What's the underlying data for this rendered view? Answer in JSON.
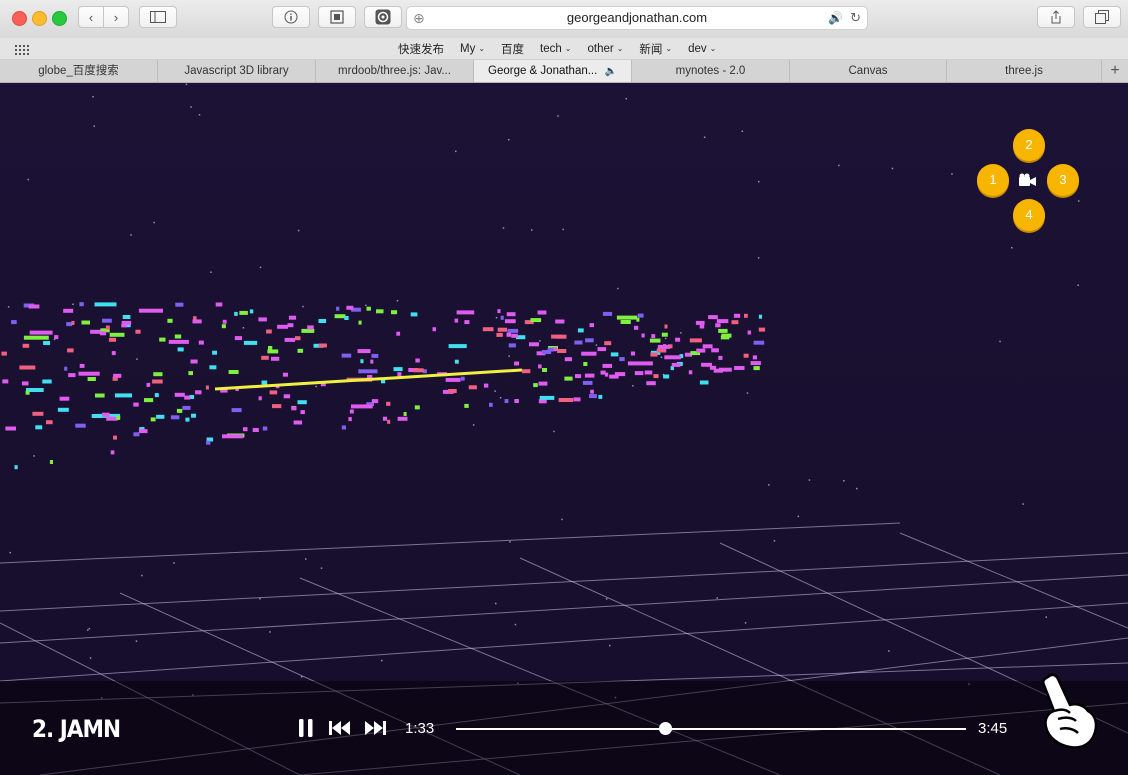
{
  "browser": {
    "url": "georgeandjonathan.com",
    "bookmarks": [
      {
        "label": "快速发布",
        "menu": false
      },
      {
        "label": "My",
        "menu": true
      },
      {
        "label": "百度",
        "menu": false
      },
      {
        "label": "tech",
        "menu": true
      },
      {
        "label": "other",
        "menu": true
      },
      {
        "label": "新闻",
        "menu": true
      },
      {
        "label": "dev",
        "menu": true
      }
    ],
    "tabs": [
      {
        "label": "globe_百度搜索",
        "active": false
      },
      {
        "label": "Javascript 3D library",
        "active": false
      },
      {
        "label": "mrdoob/three.js: Jav...",
        "active": false
      },
      {
        "label": "George & Jonathan...",
        "active": true,
        "audio": true
      },
      {
        "label": "mynotes - 2.0",
        "active": false
      },
      {
        "label": "Canvas",
        "active": false
      },
      {
        "label": "three.js",
        "active": false
      }
    ]
  },
  "player": {
    "track_title": "2. JAMN",
    "current_time": "1:33",
    "duration": "3:45",
    "progress": 0.41
  },
  "camera": {
    "buttons": [
      "1",
      "2",
      "3",
      "4"
    ]
  },
  "colors": {
    "background": "#1a1030",
    "camera_button": "#f7b500",
    "note_pink": "#e05cf0",
    "note_cyan": "#40e0f0",
    "note_yellow": "#f0f040",
    "note_green": "#80f040"
  }
}
